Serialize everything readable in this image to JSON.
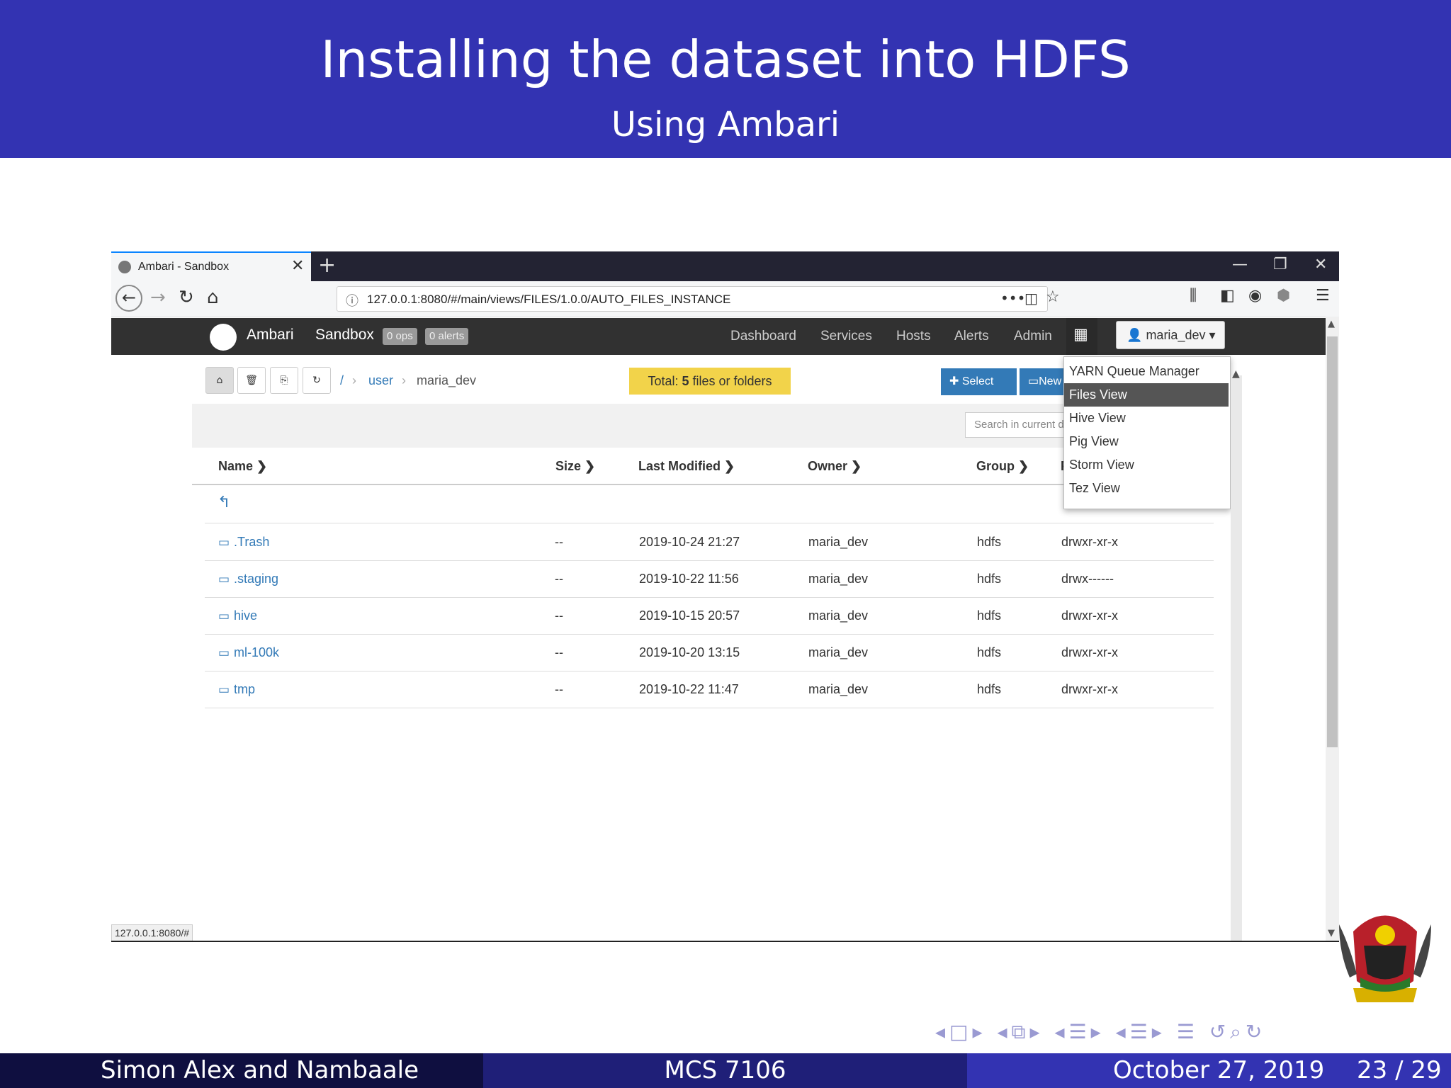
{
  "slide": {
    "title": "Installing the dataset into HDFS",
    "subtitle": "Using Ambari",
    "footer_left": "Simon Alex and Nambaale",
    "footer_center": "MCS 7106",
    "footer_date": "October 27, 2019",
    "footer_page": "23 / 29",
    "colors": {
      "header": "#3333b2",
      "footer_left": "#0f0f40",
      "footer_center": "#1f1f78",
      "footer_right": "#3333b2"
    }
  },
  "browser": {
    "tab_title": "Ambari - Sandbox",
    "url": "127.0.0.1:8080/#/main/views/FILES/1.0.0/AUTO_FILES_INSTANCE",
    "status_url": "127.0.0.1:8080/#"
  },
  "ambari": {
    "brand": "Ambari",
    "cluster": "Sandbox",
    "ops_badge": "0 ops",
    "alerts_badge": "0 alerts",
    "nav": [
      "Dashboard",
      "Services",
      "Hosts",
      "Alerts",
      "Admin"
    ],
    "user": "maria_dev",
    "views_menu": [
      "YARN Queue Manager",
      "Files View",
      "Hive View",
      "Pig View",
      "Storm View",
      "Tez View"
    ],
    "views_menu_selected": "Files View"
  },
  "files": {
    "breadcrumb": [
      "/",
      "user",
      "maria_dev"
    ],
    "total_prefix": "Total: ",
    "total_count": "5",
    "total_suffix": " files or folders",
    "select_all": "Select All",
    "new_label": "New",
    "search_placeholder": "Search in current directory...",
    "columns": [
      "Name",
      "Size",
      "Last Modified",
      "Owner",
      "Group",
      "Permission"
    ],
    "rows": [
      {
        "name": ".Trash",
        "size": "--",
        "modified": "2019-10-24 21:27",
        "owner": "maria_dev",
        "group": "hdfs",
        "perm": "drwxr-xr-x"
      },
      {
        "name": ".staging",
        "size": "--",
        "modified": "2019-10-22 11:56",
        "owner": "maria_dev",
        "group": "hdfs",
        "perm": "drwx------"
      },
      {
        "name": "hive",
        "size": "--",
        "modified": "2019-10-15 20:57",
        "owner": "maria_dev",
        "group": "hdfs",
        "perm": "drwxr-xr-x"
      },
      {
        "name": "ml-100k",
        "size": "--",
        "modified": "2019-10-20 13:15",
        "owner": "maria_dev",
        "group": "hdfs",
        "perm": "drwxr-xr-x"
      },
      {
        "name": "tmp",
        "size": "--",
        "modified": "2019-10-22 11:47",
        "owner": "maria_dev",
        "group": "hdfs",
        "perm": "drwxr-xr-x"
      }
    ]
  }
}
